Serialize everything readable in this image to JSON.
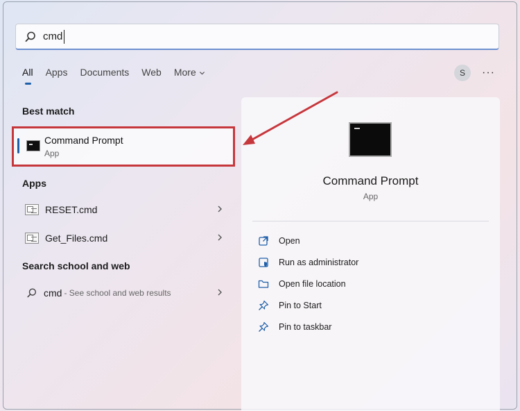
{
  "search": {
    "query": "cmd"
  },
  "tabs": [
    {
      "label": "All"
    },
    {
      "label": "Apps"
    },
    {
      "label": "Documents"
    },
    {
      "label": "Web"
    },
    {
      "label": "More"
    }
  ],
  "user": {
    "initial": "S"
  },
  "more_options": "···",
  "sections": {
    "best_match": "Best match",
    "apps": "Apps",
    "search_web": "Search school and web"
  },
  "best_match": {
    "title": "Command Prompt",
    "subtitle": "App"
  },
  "apps": [
    {
      "label": "RESET.cmd"
    },
    {
      "label": "Get_Files.cmd"
    }
  ],
  "web_result": {
    "query": "cmd",
    "suffix": "- See school and web results"
  },
  "preview": {
    "title": "Command Prompt",
    "subtitle": "App",
    "actions": [
      {
        "label": "Open",
        "icon": "open-icon"
      },
      {
        "label": "Run as administrator",
        "icon": "shield-icon"
      },
      {
        "label": "Open file location",
        "icon": "folder-icon"
      },
      {
        "label": "Pin to Start",
        "icon": "pin-icon"
      },
      {
        "label": "Pin to taskbar",
        "icon": "pin-icon"
      }
    ]
  },
  "colors": {
    "highlight_box": "#c6373c",
    "accent": "#1d5fa9"
  }
}
